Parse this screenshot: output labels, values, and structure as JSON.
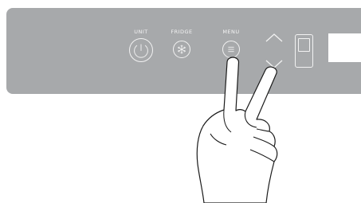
{
  "panel": {
    "controls": [
      {
        "id": "unit",
        "label": "UNIT",
        "icon": "power-icon"
      },
      {
        "id": "fridge",
        "label": "FRIDGE",
        "icon": "snowflake-icon"
      },
      {
        "id": "menu",
        "label": "MENU",
        "icon": "menu-icon"
      }
    ],
    "arrows": {
      "up_icon": "chevron-up-icon",
      "down_icon": "chevron-down-icon"
    },
    "toggle_icon": "toggle-switch-icon"
  },
  "colors": {
    "panel": "#a7a9ab",
    "foreground": "#f2f2f2",
    "hand_fill": "#ffffff",
    "hand_stroke": "#1a1a1a"
  },
  "illustration": {
    "gesture": "two-finger-swipe-hand-icon"
  }
}
